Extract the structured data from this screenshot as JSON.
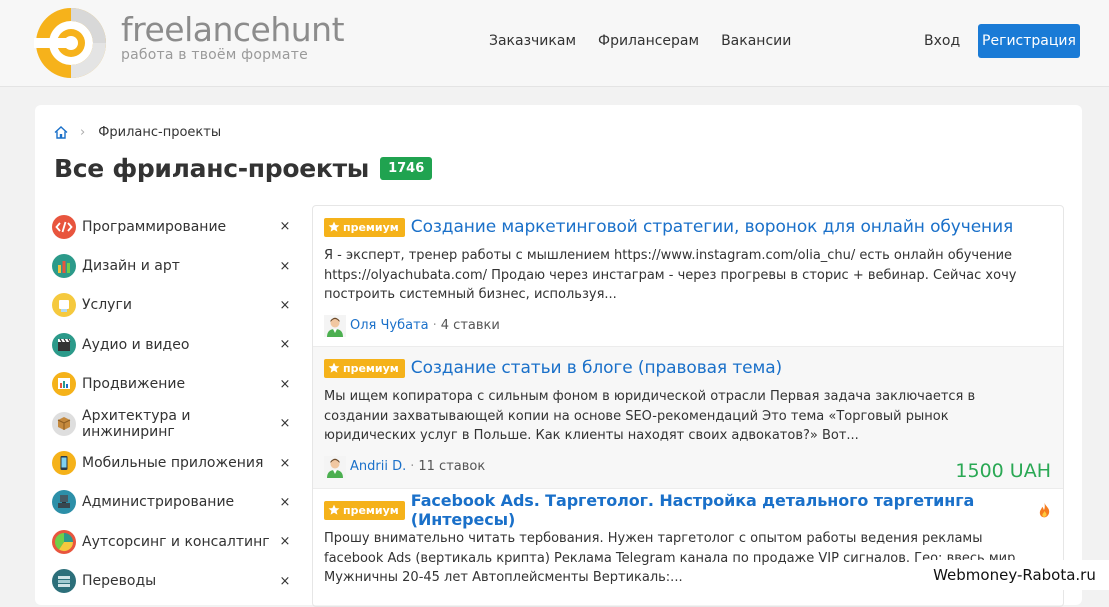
{
  "header": {
    "brand_name": "freelancehunt",
    "brand_tagline": "работа в твоём формате",
    "nav": [
      "Заказчикам",
      "Фрилансерам",
      "Вакансии"
    ],
    "login": "Вход",
    "register": "Регистрация"
  },
  "breadcrumb": {
    "current": "Фриланс-проекты"
  },
  "page": {
    "title": "Все фриланс-проекты",
    "count": "1746"
  },
  "categories": [
    {
      "label": "Программирование",
      "icon": "code-icon"
    },
    {
      "label": "Дизайн и арт",
      "icon": "paint-icon"
    },
    {
      "label": "Услуги",
      "icon": "service-icon"
    },
    {
      "label": "Аудио и видео",
      "icon": "clapper-icon"
    },
    {
      "label": "Продвижение",
      "icon": "chart-icon"
    },
    {
      "label": "Архитектура и инжиниринг",
      "icon": "box-icon"
    },
    {
      "label": "Мобильные приложения",
      "icon": "phone-icon"
    },
    {
      "label": "Администрирование",
      "icon": "server-icon"
    },
    {
      "label": "Аутсорсинг и консалтинг",
      "icon": "pie-icon"
    },
    {
      "label": "Переводы",
      "icon": "book-icon"
    }
  ],
  "premium_label": "премиум",
  "projects": [
    {
      "title": "Создание маркетинговой стратегии, воронок для онлайн обучения",
      "description": "Я - эксперт, тренер работы с мышлением https://www.instagram.com/olia_chu/ есть онлайн обучение https://olyachubata.com/ Продаю через инстаграм - через прогревы в сторис + вебинар. Сейчас хочу построить системный бизнес, используя...",
      "author": "Оля Чубата",
      "bids": "4 ставки",
      "price": ""
    },
    {
      "title": "Создание статьи в блоге (правовая тема)",
      "description": "Мы ищем копиратора с сильным фоном в юридической отрасли Первая задача заключается в создании захватывающей копии на основе SEO-рекомендаций Это тема «Торговый рынок юридических услуг в Польше. Как клиенты находят своих адвокатов?» Вот...",
      "author": "Andrii D.",
      "bids": "11 ставок",
      "price": "1500 UAH"
    },
    {
      "title": "Facebook Ads. Таргетолог. Настройка детального таргетинга (Интересы)",
      "description": "Прошу внимательно читать тербования. Нужен таргетолог с опытом работы ведения рекламы facebook Ads (вертикаль крипта) Реклама Telegram канала по продаже VIP сигналов. Гео: ввесь мир Мужничны 20-45 лет Автоплейсменты Вертикаль:...",
      "author": "",
      "bids": "",
      "price": ""
    }
  ],
  "close_symbol": "×",
  "watermark": "Webmoney-Rabota.ru"
}
